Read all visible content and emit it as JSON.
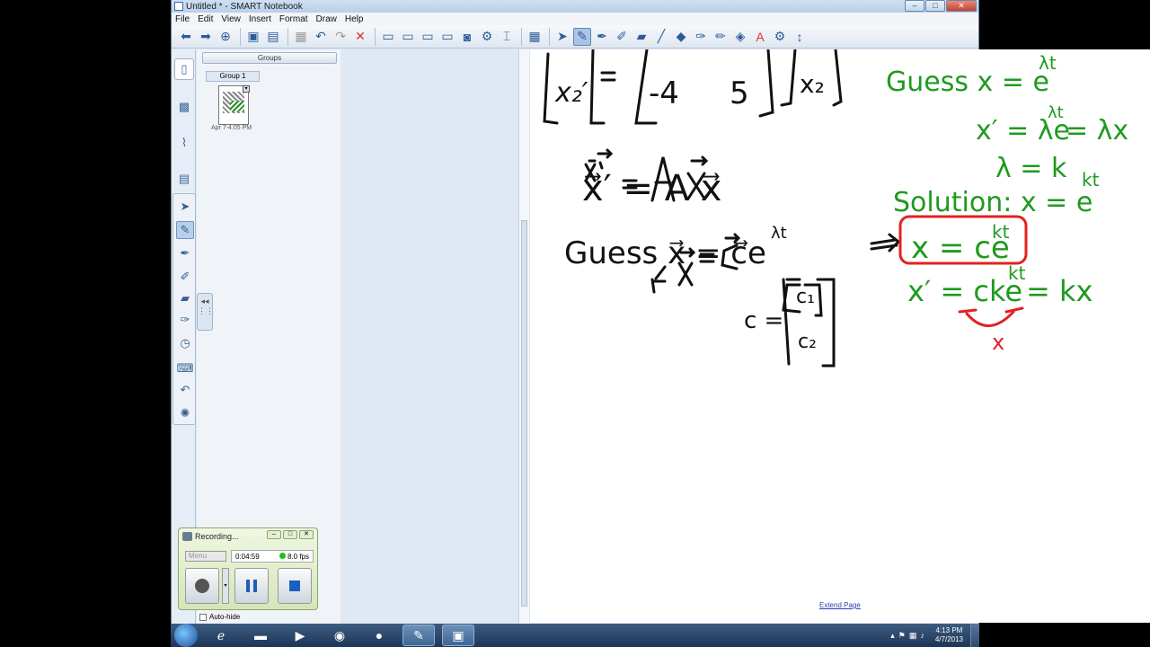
{
  "window": {
    "title": "Untitled * - SMART Notebook",
    "controls": [
      "–",
      "□",
      "✕"
    ]
  },
  "menu": [
    "File",
    "Edit",
    "View",
    "Insert",
    "Format",
    "Draw",
    "Help"
  ],
  "side_panel": {
    "groups_label": "Groups",
    "group_name": "Group 1",
    "thumbnail_label": "Apr 7-4:05 PM"
  },
  "canvas": {
    "extend_page": "Extend Page",
    "ink_black": {
      "top_matrix_row": "x₂′",
      "top_matrix_left": "-4",
      "top_matrix_mid": "5",
      "top_vector": "x₂",
      "equation": "x⃗′ = A x⃗",
      "guess": "Guess x⃗ = c⃗e",
      "guess_exp": "λt",
      "c_def": "c =",
      "c1": "c₁",
      "c2": "c₂"
    },
    "ink_green": {
      "guess": "Guess x = e",
      "guess_exp": "λt",
      "derivative": "x′ = λe",
      "derivative_exp": "λt",
      "derivative_tail": "= λx",
      "lambda": "λ = k",
      "solution": "Solution: x = e",
      "solution_exp": "kt",
      "boxed": "x = ce",
      "boxed_exp": "kt",
      "check": "x′ = cke",
      "check_exp": "kt",
      "check_tail": "= kx"
    },
    "ink_red": {
      "brace_label": "x"
    },
    "colors": {
      "black_ink": "#111111",
      "green_ink": "#1f9a1f",
      "red_ink": "#e22222"
    }
  },
  "recorder": {
    "title": "Recording...",
    "menu_label": "Menu",
    "elapsed": "0:04:59",
    "fps": "8.0 fps",
    "auto_hide": "Auto-hide"
  },
  "taskbar": {
    "time": "4:13 PM",
    "date": "4/7/2013"
  }
}
